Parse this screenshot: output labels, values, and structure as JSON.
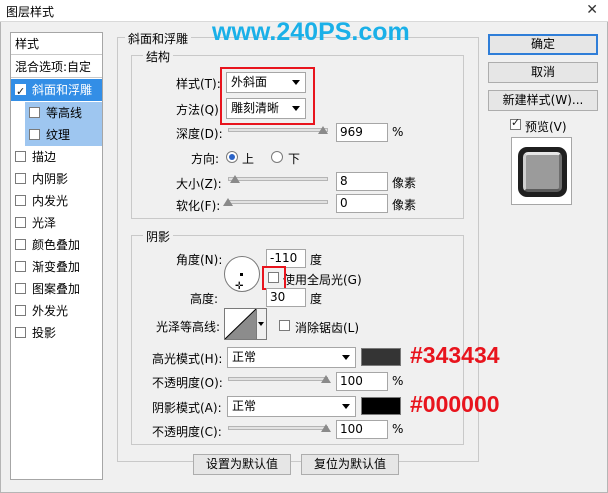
{
  "window": {
    "title": "图层样式",
    "close_glyph": "✕"
  },
  "watermark": "www.240PS.com",
  "sidebar": {
    "header": "样式",
    "blend": "混合选项:自定",
    "items": [
      {
        "label": "斜面和浮雕",
        "checked": true
      },
      {
        "label": "等高线",
        "checked": false
      },
      {
        "label": "纹理",
        "checked": false
      },
      {
        "label": "描边",
        "checked": false
      },
      {
        "label": "内阴影",
        "checked": false
      },
      {
        "label": "内发光",
        "checked": false
      },
      {
        "label": "光泽",
        "checked": false
      },
      {
        "label": "颜色叠加",
        "checked": false
      },
      {
        "label": "渐变叠加",
        "checked": false
      },
      {
        "label": "图案叠加",
        "checked": false
      },
      {
        "label": "外发光",
        "checked": false
      },
      {
        "label": "投影",
        "checked": false
      }
    ]
  },
  "bevel": {
    "section_title": "斜面和浮雕",
    "structure_title": "结构",
    "style_label": "样式(T):",
    "style_value": "外斜面",
    "technique_label": "方法(Q):",
    "technique_value": "雕刻清晰",
    "depth_label": "深度(D):",
    "depth_value": "969",
    "depth_unit": "%",
    "depth_fraction": 0.97,
    "direction_label": "方向:",
    "dir_up": "上",
    "dir_down": "下",
    "size_label": "大小(Z):",
    "size_value": "8",
    "size_unit": "像素",
    "soften_label": "软化(F):",
    "soften_value": "0",
    "soften_unit": "像素"
  },
  "shading": {
    "title": "阴影",
    "angle_label": "角度(N):",
    "angle_value": "-110",
    "angle_unit": "度",
    "global_light_label": "使用全局光(G)",
    "altitude_label": "高度:",
    "altitude_value": "30",
    "altitude_unit": "度",
    "gloss_label": "光泽等高线:",
    "antialias_label": "消除锯齿(L)",
    "highlight_mode_label": "高光模式(H):",
    "highlight_mode_value": "正常",
    "highlight_color": "#343434",
    "highlight_color_text": "#343434",
    "highlight_opacity_label": "不透明度(O):",
    "highlight_opacity_value": "100",
    "highlight_opacity_unit": "%",
    "shadow_mode_label": "阴影模式(A):",
    "shadow_mode_value": "正常",
    "shadow_color": "#000000",
    "shadow_color_text": "#000000",
    "shadow_opacity_label": "不透明度(C):",
    "shadow_opacity_value": "100",
    "shadow_opacity_unit": "%"
  },
  "footer": {
    "set_default": "设置为默认值",
    "reset_default": "复位为默认值"
  },
  "right": {
    "ok": "确定",
    "cancel": "取消",
    "new_style": "新建样式(W)...",
    "preview_label": "预览(V)",
    "preview_checked": true
  }
}
